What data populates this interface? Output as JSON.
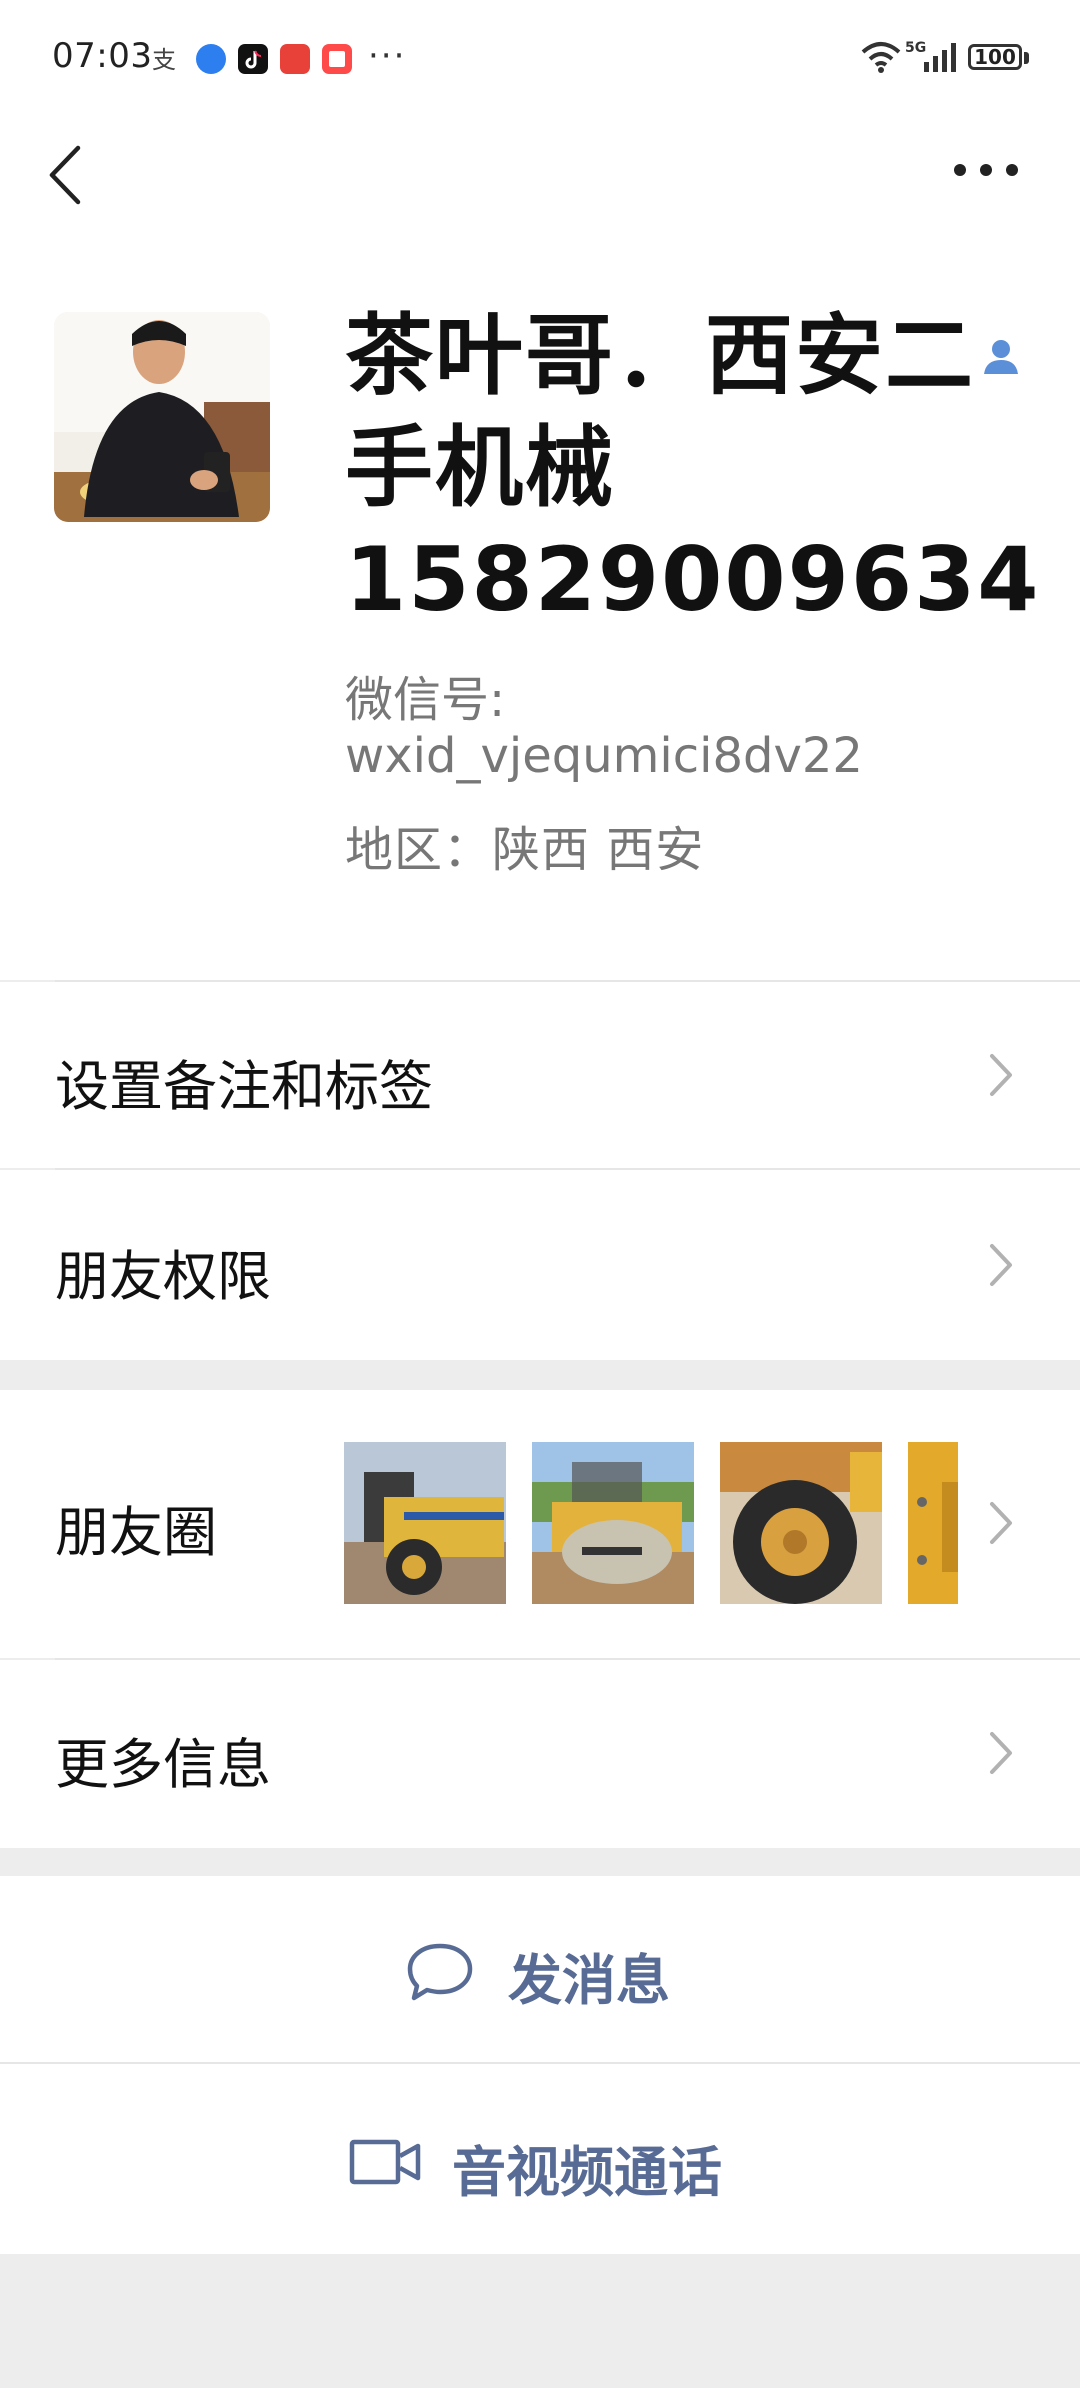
{
  "status_bar": {
    "time": "07:03",
    "network": "5G",
    "battery": "100",
    "overflow": "···",
    "apps": [
      "alipay-icon",
      "browser-icon",
      "tiktok-icon",
      "app-red-icon",
      "reader-icon"
    ]
  },
  "header": {
    "back_icon": "chevron-left-icon",
    "more_icon": "more-dots-icon"
  },
  "profile": {
    "name": "茶叶哥．西安二手机械15829009634",
    "wechat_id_label": "微信号:",
    "wechat_id": "wxid_vjequmici8dv22",
    "region": "地区：陕西  西安",
    "contact_icon": "contact-person-icon"
  },
  "rows": {
    "remarks": "设置备注和标签",
    "permissions": "朋友权限",
    "moments": "朋友圈",
    "more_info": "更多信息"
  },
  "actions": {
    "send_message": "发消息",
    "av_call": "音视频通话"
  },
  "colors": {
    "accent": "#576b95",
    "background": "#ededed",
    "divider": "#e6e6e6",
    "text_secondary": "#777777"
  }
}
